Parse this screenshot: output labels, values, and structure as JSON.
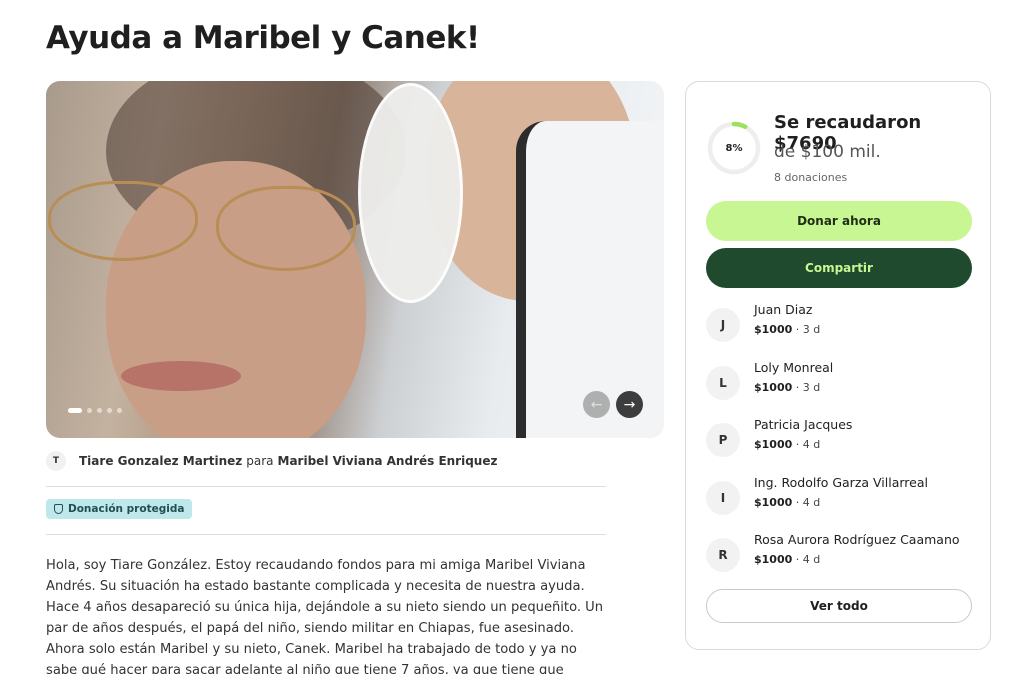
{
  "page": {
    "title": "Ayuda a Maribel y Canek!"
  },
  "gallery": {
    "slides": 5,
    "active_slide": 1
  },
  "organizer": {
    "initial": "T",
    "name": "Tiare Gonzalez Martinez",
    "connector": "para",
    "beneficiary": "Maribel Viviana Andrés Enriquez"
  },
  "badge": {
    "label": "Donación protegida"
  },
  "story": {
    "text": "Hola, soy Tiare González. Estoy recaudando fondos para mi amiga Maribel Viviana Andrés. Su situación ha estado bastante complicada y necesita de nuestra ayuda. Hace 4 años desapareció su única hija, dejándole a su nieto siendo un pequeñito. Un par de años después, el papá del niño, siendo militar en Chiapas, fue asesinado. Ahora solo están Maribel y su nieto, Canek. Maribel ha trabajado de todo y ya no sabe qué hacer para sacar adelante al niño que tiene 7 años, ya que tiene que mantenerlo y cuidar de el a la vez, y"
  },
  "progress": {
    "percent_label": "8%",
    "percent_value": 0.0769,
    "raised": "Se recaudaron $7690",
    "goal": "de $100 mil.",
    "donations_count": "8 donaciones",
    "color": "#9be15d"
  },
  "actions": {
    "donate_label": "Donar ahora",
    "share_label": "Compartir",
    "see_all_label": "Ver todo"
  },
  "donors": [
    {
      "initial": "J",
      "name": "Juan Diaz",
      "amount": "$1000",
      "time": "3 d"
    },
    {
      "initial": "L",
      "name": "Loly Monreal",
      "amount": "$1000",
      "time": "3 d"
    },
    {
      "initial": "P",
      "name": "Patricia Jacques",
      "amount": "$1000",
      "time": "4 d"
    },
    {
      "initial": "I",
      "name": "Ing. Rodolfo Garza Villarreal",
      "amount": "$1000",
      "time": "4 d"
    },
    {
      "initial": "R",
      "name": "Rosa Aurora Rodríguez Caamano",
      "amount": "$1000",
      "time": "4 d"
    }
  ],
  "colors": {
    "donate_bg": "#c7f692",
    "share_bg": "#1f4a2e",
    "badge_bg": "#bfe8ea"
  }
}
